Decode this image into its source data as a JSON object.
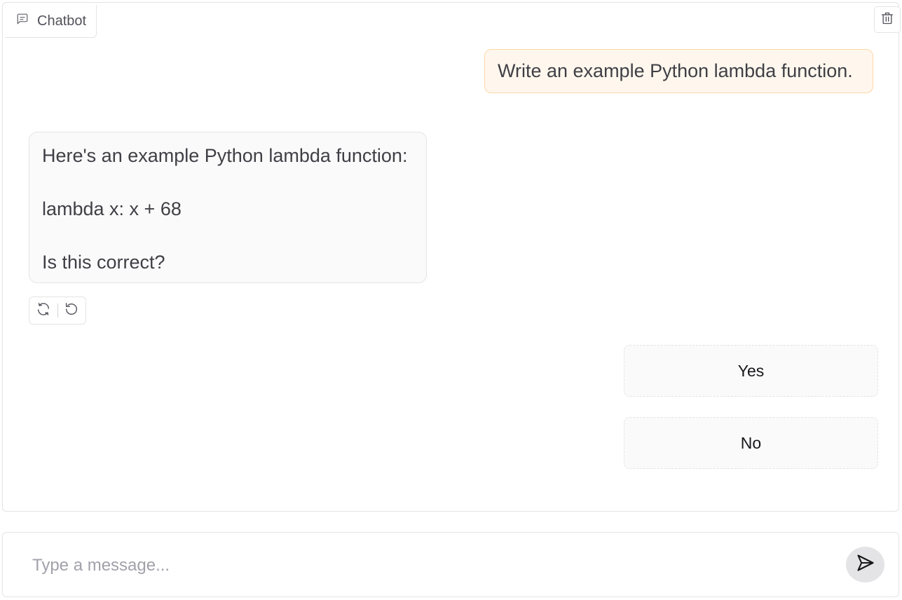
{
  "chatbot": {
    "label": "Chatbot",
    "icons": {
      "label": "chat-bubble-icon",
      "clear": "trash-icon"
    }
  },
  "messages": {
    "user": "Write an example Python lambda function.",
    "bot": {
      "line1": "Here's an example Python lambda function:",
      "line2": "lambda x: x + 68",
      "line3": "Is this correct?"
    },
    "action_icons": [
      "retry-icon",
      "undo-icon"
    ]
  },
  "options": {
    "yes": "Yes",
    "no": "No"
  },
  "input": {
    "placeholder": "Type a message...",
    "value": "",
    "send_icon": "send-icon"
  },
  "colors": {
    "user_bubble_bg": "#fff7ed",
    "user_bubble_border": "#fed7aa",
    "bot_bubble_bg": "#fafafa",
    "border": "#e4e4e7"
  }
}
